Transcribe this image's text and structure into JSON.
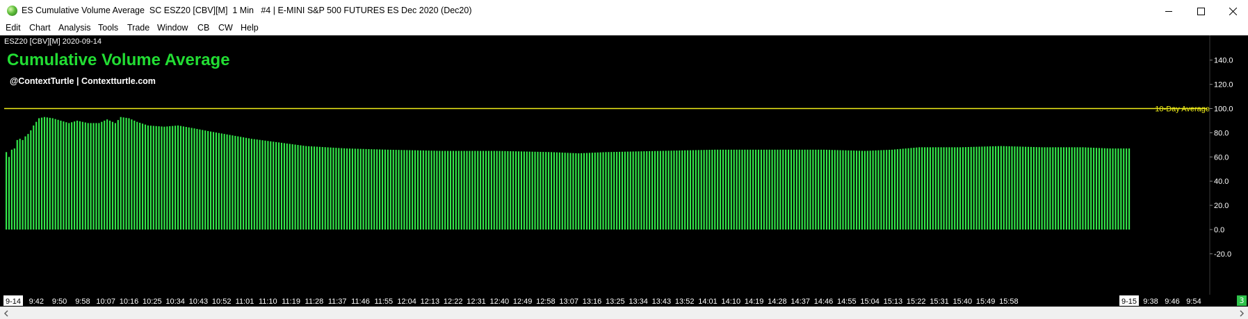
{
  "window": {
    "title": "ES Cumulative Volume Average  SC ESZ20 [CBV][M]  1 Min   #4 | E-MINI S&P 500 FUTURES ES Dec 2020 (Dec20)",
    "icon": "globe-app-icon",
    "controls": [
      "minimize-icon",
      "maximize-icon",
      "close-icon"
    ]
  },
  "menu": {
    "items": [
      "Edit",
      "Chart",
      "Analysis",
      "Tools",
      "Trade",
      "Window",
      "CB",
      "CW",
      "Help"
    ]
  },
  "chart": {
    "symbol_label": "ESZ20 [CBV][M] 2020-09-14",
    "heading": "Cumulative Volume Average",
    "subheading": "@ContextTurtle | Contextturtle.com",
    "reference_label": "10-Day Average",
    "corner_badge": "3",
    "colors": {
      "background": "#000000",
      "bars": "#33e84a",
      "reference": "#f2ef1a",
      "heading": "#22dd33",
      "text": "#ffffff"
    }
  },
  "chart_data": {
    "type": "bar",
    "title": "Cumulative Volume Average",
    "ylim": [
      0,
      150
    ],
    "yticks": [
      "140.0",
      "120.0",
      "100.0",
      "80.0",
      "60.0",
      "40.0",
      "20.0",
      "0.0",
      "-20.0"
    ],
    "reference_line": {
      "name": "10-Day Average",
      "value": 100
    },
    "xtick_labels": [
      "9-14",
      "9:42",
      "9:50",
      "9:58",
      "10:07",
      "10:16",
      "10:25",
      "10:34",
      "10:43",
      "10:52",
      "11:01",
      "11:10",
      "11:19",
      "11:28",
      "11:37",
      "11:46",
      "11:55",
      "12:04",
      "12:13",
      "12:22",
      "12:31",
      "12:40",
      "12:49",
      "12:58",
      "13:07",
      "13:16",
      "13:25",
      "13:34",
      "13:43",
      "13:52",
      "14:01",
      "14:10",
      "14:19",
      "14:28",
      "14:37",
      "14:46",
      "14:55",
      "15:04",
      "15:13",
      "15:22",
      "15:31",
      "15:40",
      "15:49",
      "15:58",
      "9-15",
      "9:38",
      "9:46",
      "9:54"
    ],
    "profile_keypoints": [
      [
        0,
        64
      ],
      [
        1,
        60
      ],
      [
        2,
        66
      ],
      [
        3,
        67
      ],
      [
        4,
        74
      ],
      [
        5,
        75
      ],
      [
        6,
        74
      ],
      [
        7,
        77
      ],
      [
        8,
        79
      ],
      [
        9,
        82
      ],
      [
        10,
        86
      ],
      [
        12,
        92
      ],
      [
        14,
        93
      ],
      [
        17,
        92
      ],
      [
        20,
        90
      ],
      [
        23,
        88
      ],
      [
        26,
        90
      ],
      [
        30,
        88
      ],
      [
        34,
        88
      ],
      [
        37,
        91
      ],
      [
        40,
        88
      ],
      [
        42,
        93
      ],
      [
        45,
        92
      ],
      [
        48,
        89
      ],
      [
        52,
        86
      ],
      [
        58,
        85
      ],
      [
        63,
        86
      ],
      [
        68,
        84
      ],
      [
        75,
        81
      ],
      [
        80,
        79
      ],
      [
        85,
        77
      ],
      [
        90,
        75
      ],
      [
        100,
        72
      ],
      [
        110,
        69
      ],
      [
        125,
        67
      ],
      [
        140,
        66
      ],
      [
        160,
        65
      ],
      [
        180,
        65
      ],
      [
        200,
        64
      ],
      [
        210,
        63
      ],
      [
        220,
        64
      ],
      [
        240,
        65
      ],
      [
        260,
        66
      ],
      [
        280,
        66
      ],
      [
        300,
        66
      ],
      [
        315,
        65
      ],
      [
        325,
        66
      ],
      [
        335,
        68
      ],
      [
        350,
        68
      ],
      [
        365,
        69
      ],
      [
        380,
        68
      ],
      [
        395,
        68
      ],
      [
        405,
        67
      ],
      [
        412,
        67
      ]
    ],
    "bar_count": 413
  }
}
